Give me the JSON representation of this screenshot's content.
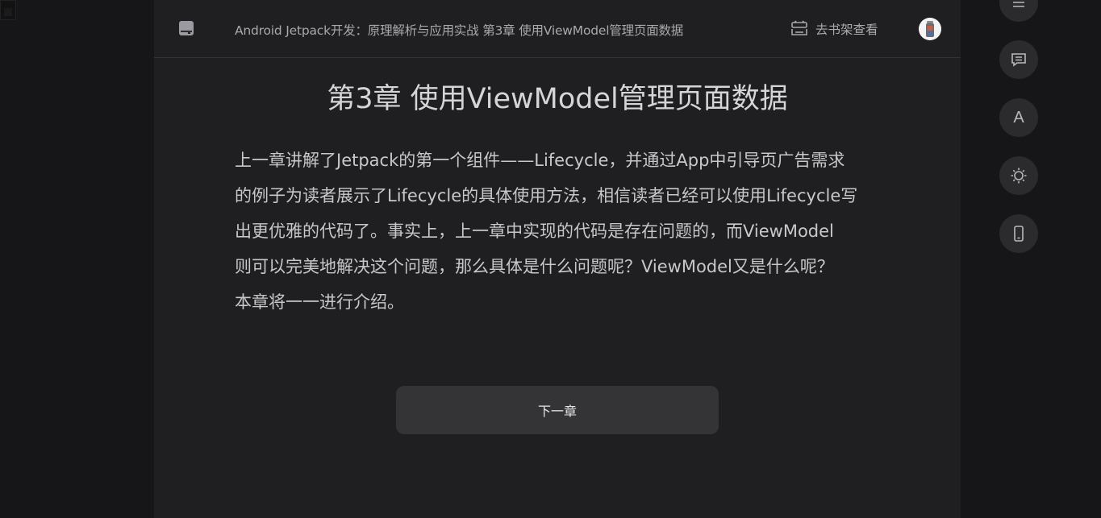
{
  "header": {
    "book_title": "Android Jetpack开发：原理解析与应用实战 第3章 使用ViewModel管理页面数据",
    "shelf_label": "去书架查看"
  },
  "chapter": {
    "title": "第3章 使用ViewModel管理页面数据",
    "lines": [
      "上一章讲解了Jetpack的第一个组件——Lifecycle，并通过App中引导页广告需求",
      "的例子为读者展示了Lifecycle的具体使用方法，相信读者已经可以使用Lifecycle写",
      "出更优雅的代码了。事实上，上一章中实现的代码是存在问题的，而ViewModel",
      "则可以完美地解决这个问题，那么具体是什么问题呢？ViewModel又是什么呢？",
      "本章将一一进行介绍。"
    ]
  },
  "next_button": {
    "label": "下一章"
  },
  "side_toolbar": {
    "font_label": "A",
    "icons": [
      "menu-icon",
      "comment-icon",
      "font-icon",
      "brightness-icon",
      "phone-icon"
    ]
  },
  "colors": {
    "page_bg": "#161618",
    "reader_bg": "#1f1f21",
    "button_bg": "#343437",
    "text": "#c8c8cc"
  }
}
